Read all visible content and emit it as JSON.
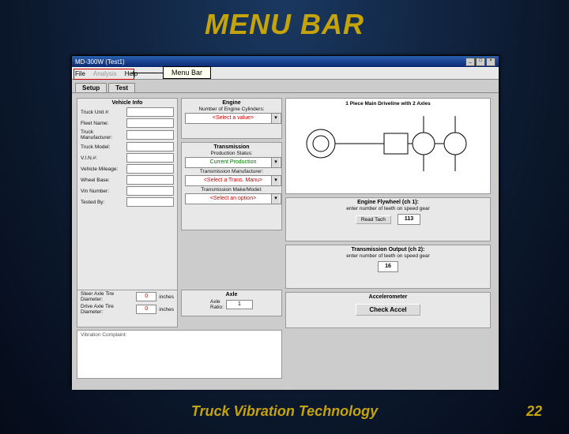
{
  "slide": {
    "title": "MENU BAR",
    "footer_left": "Truck Vibration Technology",
    "page_number": "22"
  },
  "callout": {
    "label": "Menu Bar"
  },
  "window": {
    "title": "MD-300W (Test1)"
  },
  "menu": {
    "file": "File",
    "analysis": "Analysis",
    "help": "Help"
  },
  "tabs": {
    "setup": "Setup",
    "test": "Test"
  },
  "vehicle": {
    "title": "Vehicle Info",
    "truck_unit": "Truck Unit #:",
    "fleet_name": "Fleet Name:",
    "manufacturer": "Truck Manufacturer:",
    "model": "Truck Model:",
    "vin": "V.I.N.#:",
    "mileage": "Vehicle Mileage:",
    "wheelbase": "Wheel Base:",
    "vin_number": "Vin Number:",
    "tested_by": "Tested By:"
  },
  "engine": {
    "title": "Engine",
    "cyl_label": "Number of Engine Cylinders:",
    "cyl_value": "<Select a value>"
  },
  "transmission": {
    "title": "Transmission",
    "prod_label": "Production Status:",
    "prod_value": "Current Production",
    "manu_label": "Transmission Manufacturer:",
    "manu_value": "<Select a Trans. Manu>",
    "make_label": "Transmission Make/Model:",
    "make_value": "<Select an option>"
  },
  "tires": {
    "steer_label": "Steer Axle Tire Diameter:",
    "steer_value": "0",
    "drive_label": "Drive Axle Tire Diameter:",
    "drive_value": "0",
    "unit": "inches"
  },
  "axle": {
    "title": "Axle",
    "ratio_label": "Axle Ratio:",
    "ratio_value": "1"
  },
  "diagram": {
    "title": "1 Piece Main Driveline with 2 Axles"
  },
  "flywheel": {
    "title": "Engine Flywheel (ch 1):",
    "hint": "enter number of teeth on speed gear",
    "read_tach": "Read Tach",
    "value": "113"
  },
  "trans_out": {
    "title": "Transmission Output (ch 2):",
    "hint": "enter number of teeth on speed gear",
    "value": "16"
  },
  "accel": {
    "title": "Accelerometer",
    "btn": "Check Accel"
  },
  "complaint": {
    "title": "Vibration Complaint:"
  }
}
